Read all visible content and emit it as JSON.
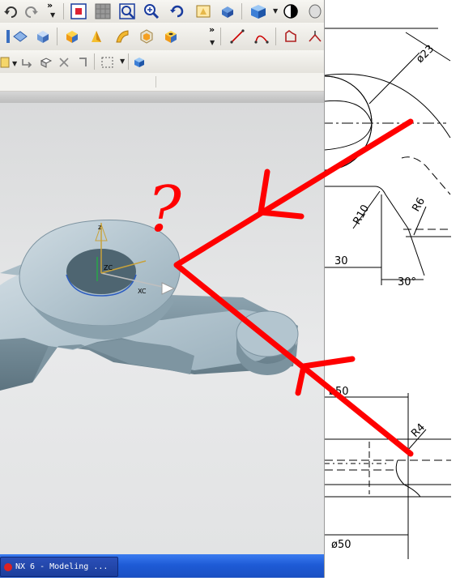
{
  "app": {
    "toolbar_overflow_glyph": "»"
  },
  "drawing": {
    "dims": {
      "phi23": "ø23",
      "r10": "R10",
      "r6": "R6",
      "d30_len": "30",
      "d30_ang": "30°",
      "phi50_top": "ø50",
      "r4": "R4",
      "phi50_bottom": "ø50"
    }
  },
  "annotation": {
    "question_mark": "?",
    "color": "#ff0000"
  },
  "taskbar": {
    "task_label": "NX 6 - Modeling ..."
  },
  "icons": [
    "undo-icon",
    "redo-icon",
    "fit-view-icon",
    "zoom-icon",
    "rotate-icon",
    "pan-icon",
    "shaded-cube-icon",
    "sketch-icon",
    "extrude-icon",
    "line-icon",
    "arc-icon"
  ]
}
